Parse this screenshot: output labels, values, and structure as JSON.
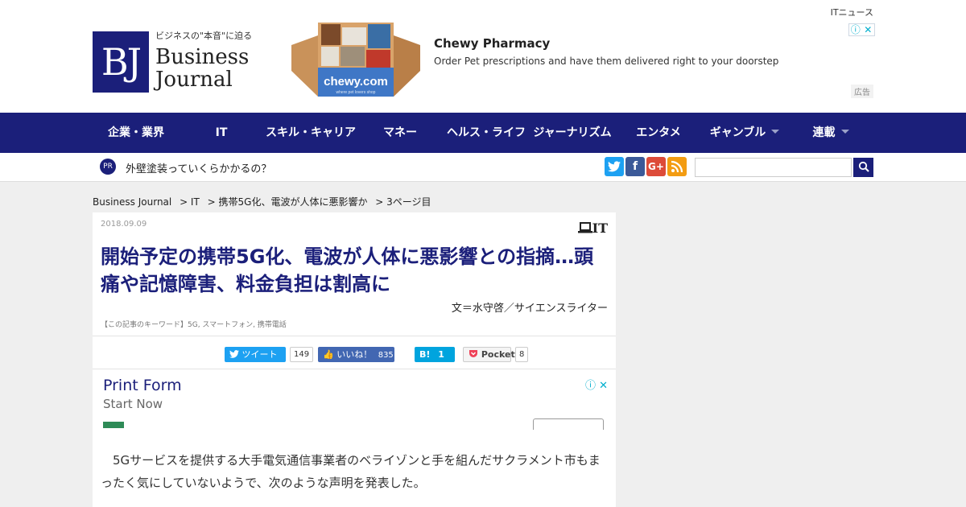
{
  "header": {
    "top_link": "ITニュース",
    "logo": {
      "mark": "BJ",
      "tagline": "ビジネスの\"本音\"に迫る",
      "name_line1": "Business",
      "name_line2": "Journal"
    },
    "ad": {
      "title": "Chewy Pharmacy",
      "description": "Order Pet prescriptions and have them delivered right to your doorstep",
      "label": "広告",
      "image_brand": "chewy.com",
      "image_tagline": "where pet lovers shop"
    }
  },
  "nav": {
    "items": [
      {
        "label": "企業・業界",
        "dropdown": false
      },
      {
        "label": "IT",
        "dropdown": false
      },
      {
        "label": "スキル・キャリア",
        "dropdown": false
      },
      {
        "label": "マネー",
        "dropdown": false
      },
      {
        "label": "ヘルス・ライフ",
        "dropdown": false
      },
      {
        "label": "ジャーナリズム",
        "dropdown": false
      },
      {
        "label": "エンタメ",
        "dropdown": false
      },
      {
        "label": "ギャンブル",
        "dropdown": true
      },
      {
        "label": "連載",
        "dropdown": true
      }
    ]
  },
  "prbar": {
    "badge": "PR",
    "text": "外壁塗装っていくらかかるの？",
    "search_placeholder": ""
  },
  "breadcrumb": [
    "Business Journal",
    "> IT",
    "> 携帯5G化、電波が人体に悪影響か",
    "> 3ページ目"
  ],
  "article": {
    "date": "2018.09.09",
    "category": "IT",
    "title": "開始予定の携帯5G化、電波が人体に悪影響との指摘…頭痛や記憶障害、料金負担は割高に",
    "author": "文＝水守啓／サイエンスライター",
    "keywords": "【この記事のキーワード】5G, スマートフォン, 携帯電話",
    "share": {
      "tweet_label": "ツイート",
      "tweet_count": "149",
      "like_label": "いいね！",
      "like_count": "835",
      "hatena_label": "B!",
      "hatena_count": "1",
      "pocket_label": "Pocket",
      "pocket_count": "8"
    },
    "ad": {
      "title": "Print Form",
      "subtitle": "Start Now"
    },
    "body": "　5Gサービスを提供する大手電気通信事業者のベライゾンと手を組んだサクラメント市もまったく気にしていないようで、次のような声明を発表した。"
  },
  "colors": {
    "brand_navy": "#1b1f7a",
    "twitter": "#1da1f2",
    "facebook": "#3b5998",
    "google_plus": "#dd4b39",
    "rss": "#f39c12",
    "hatena": "#00a4de"
  }
}
